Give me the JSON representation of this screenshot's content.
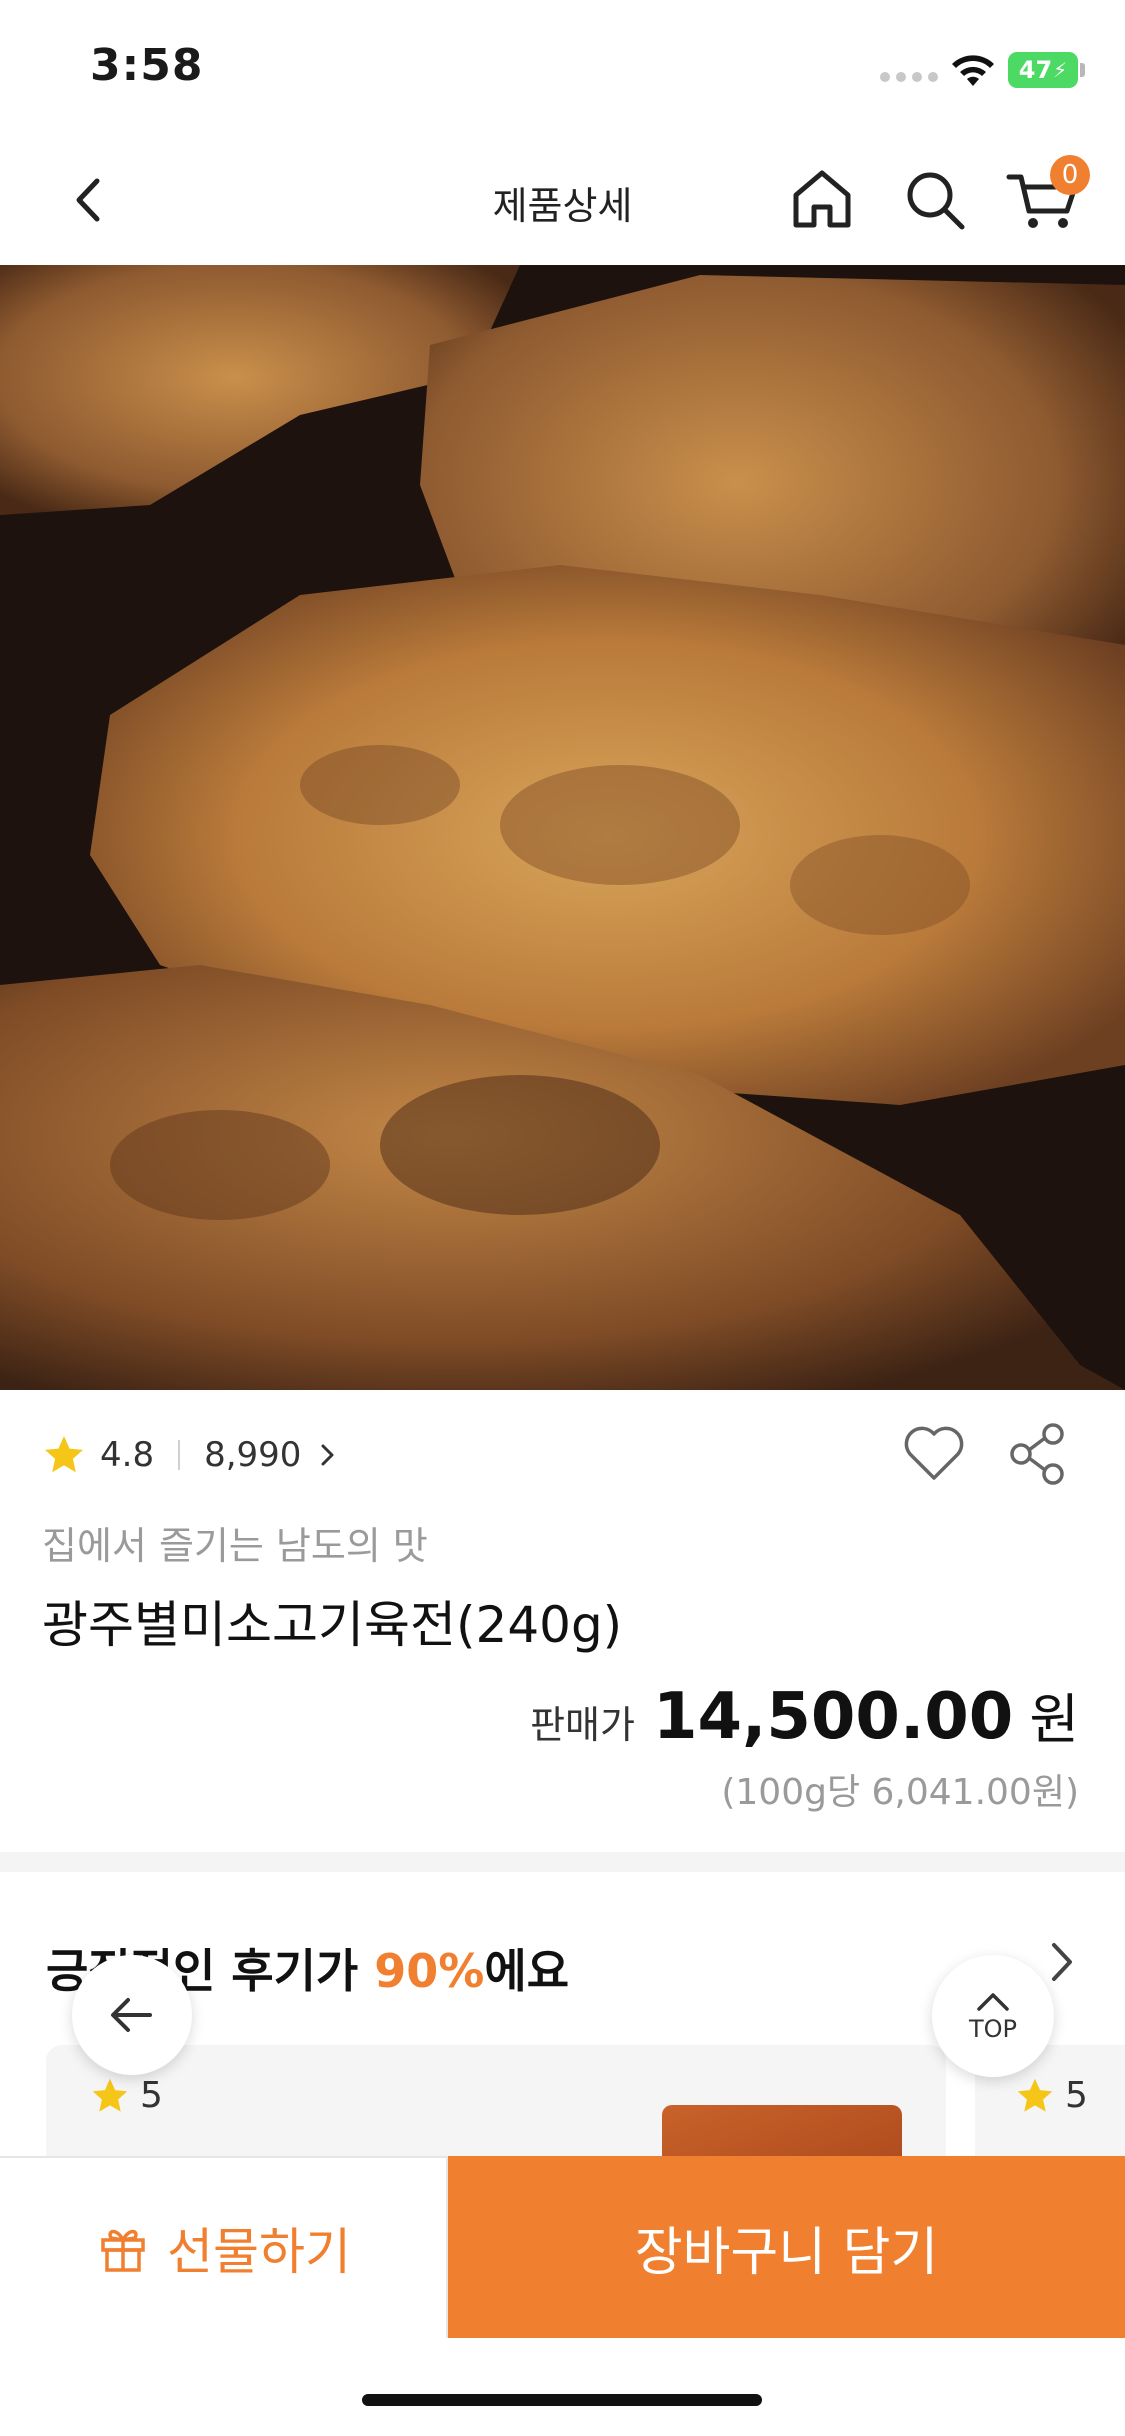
{
  "status_bar": {
    "time": "3:58",
    "battery": "47"
  },
  "nav": {
    "title": "제품상세",
    "cart_count": "0"
  },
  "hero": {
    "image_description_icon": "food-photo",
    "slide_count": 3,
    "active_slide": 1
  },
  "product": {
    "rating": "4.8",
    "review_count": "8,990",
    "subtitle": "집에서 즐기는 남도의 맛",
    "name": "광주별미소고기육전(240g)",
    "price_label": "판매가",
    "price": "14,500.00",
    "price_unit": "원",
    "unit_price": "(100g당 6,041.00원)"
  },
  "reviews": {
    "title_prefix": "긍정적인 후기가 ",
    "title_percent": "90%",
    "title_suffix": "에요",
    "cards": [
      {
        "rating": "5"
      },
      {
        "rating": "5"
      }
    ]
  },
  "floating": {
    "top_label": "TOP"
  },
  "actions": {
    "gift_label": "선물하기",
    "cart_label": "장바구니 담기"
  },
  "colors": {
    "accent": "#f07f2f",
    "star": "#f5c518"
  }
}
